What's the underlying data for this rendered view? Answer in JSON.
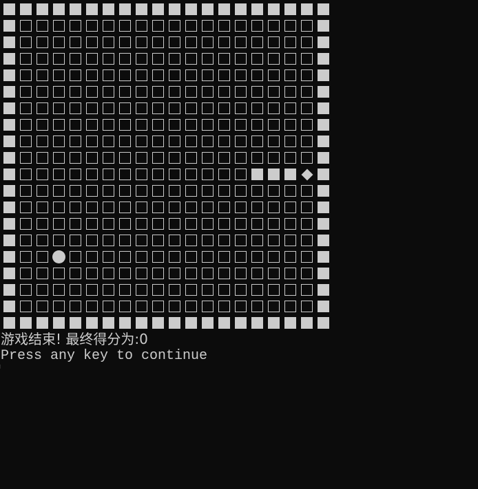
{
  "window": {
    "background": "#0c0c0c",
    "foreground": "#cccccc"
  },
  "board": {
    "rows": 20,
    "cols": 20,
    "wall_icon": "filled-square",
    "empty_icon": "hollow-square",
    "snake_body_icon": "filled-square",
    "snake_head_icon": "diamond",
    "food_icon": "filled-circle",
    "snake": {
      "head": {
        "row": 10,
        "col": 18
      },
      "body": [
        {
          "row": 10,
          "col": 17
        },
        {
          "row": 10,
          "col": 16
        },
        {
          "row": 10,
          "col": 15
        }
      ]
    },
    "food": {
      "row": 15,
      "col": 3
    }
  },
  "messages": {
    "game_over": "游戏结束! 最终得分为:0",
    "prompt": "Press any key to continue"
  }
}
